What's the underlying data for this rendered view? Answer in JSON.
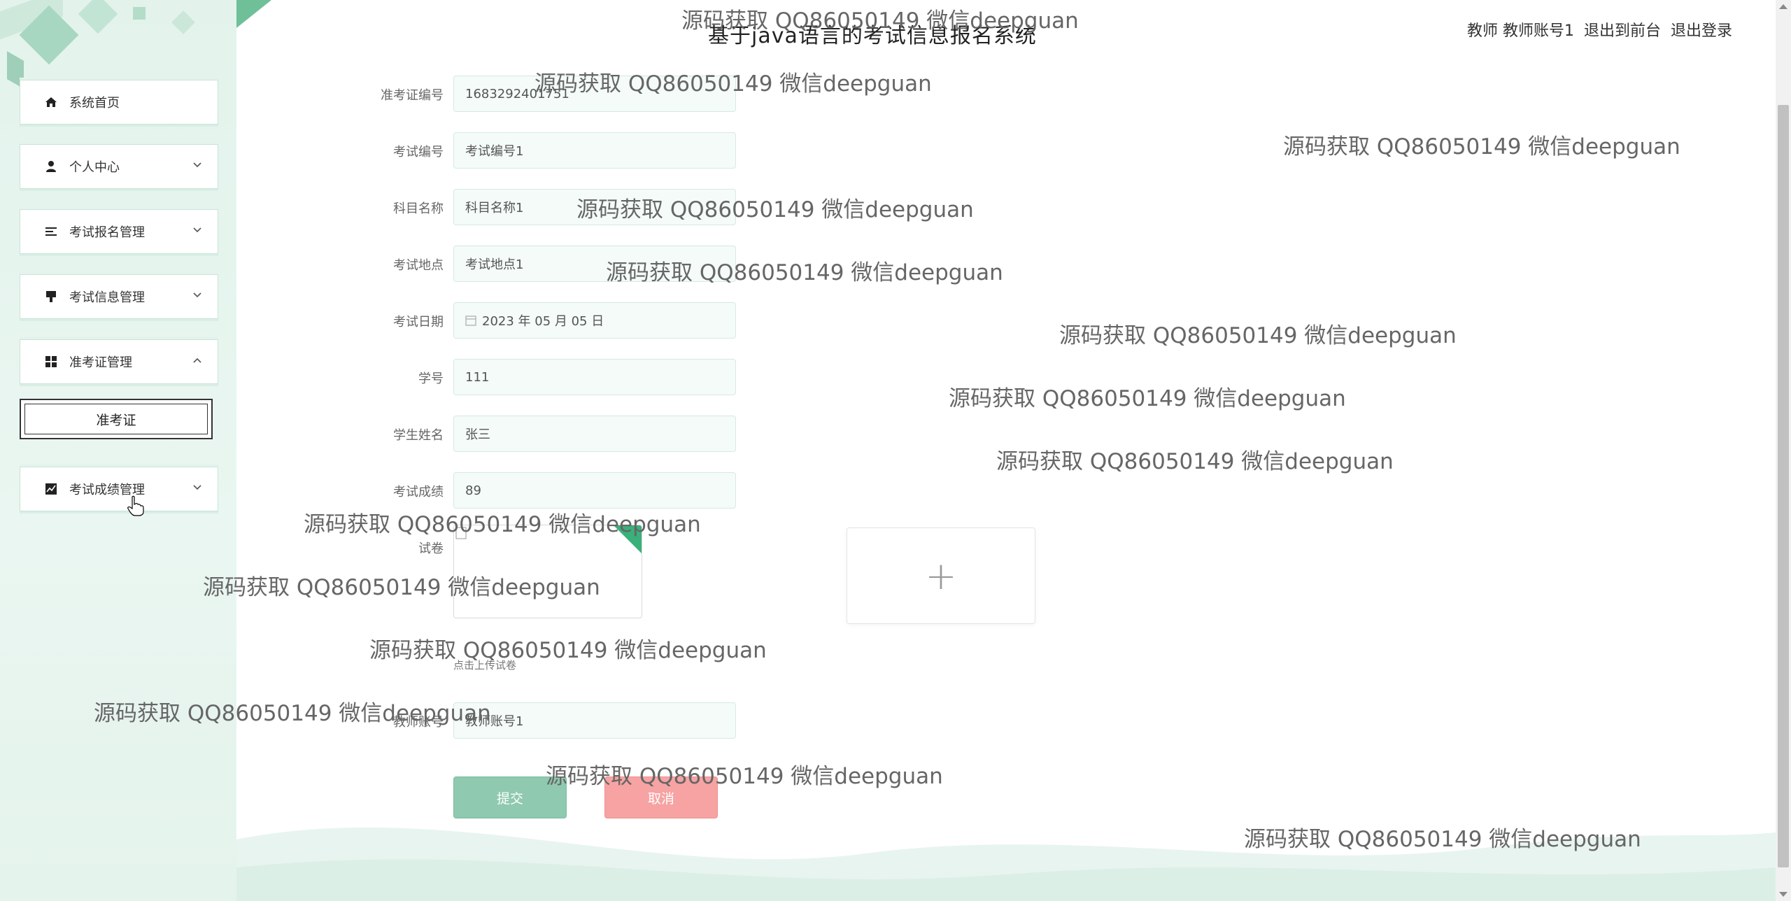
{
  "header": {
    "title": "基于java语言的考试信息报名系统",
    "user_label": "教师 教师账号1",
    "to_front_label": "退出到前台",
    "logout_label": "退出登录"
  },
  "sidebar": {
    "items": [
      {
        "label": "系统首页",
        "icon": "home-icon"
      },
      {
        "label": "个人中心",
        "icon": "user-icon"
      },
      {
        "label": "考试报名管理",
        "icon": "list-icon"
      },
      {
        "label": "考试信息管理",
        "icon": "brush-icon"
      },
      {
        "label": "准考证管理",
        "icon": "grid-icon"
      },
      {
        "label": "考试成绩管理",
        "icon": "chart-icon"
      }
    ],
    "sub_item": "准考证"
  },
  "form": {
    "fields": [
      {
        "label": "准考证编号",
        "value": "1683292401751"
      },
      {
        "label": "考试编号",
        "value": "考试编号1"
      },
      {
        "label": "科目名称",
        "value": "科目名称1"
      },
      {
        "label": "考试地点",
        "value": "考试地点1"
      },
      {
        "label": "考试日期",
        "value": "2023 年 05 月 05 日"
      },
      {
        "label": "学号",
        "value": "111"
      },
      {
        "label": "学生姓名",
        "value": "张三"
      },
      {
        "label": "考试成绩",
        "value": "89"
      }
    ],
    "paper_label": "试卷",
    "upload_plus": "+",
    "upload_hint": "点击上传试卷",
    "teacher_label": "教师账号",
    "teacher_value": "教师账号1",
    "submit_label": "提交",
    "cancel_label": "取消"
  },
  "watermark": "源码获取 QQ86050149 微信deepguan",
  "colors": {
    "accent": "#8fc9b0",
    "cancel": "#f7a3a3",
    "sidebar_bg": "#e3f3ec"
  }
}
